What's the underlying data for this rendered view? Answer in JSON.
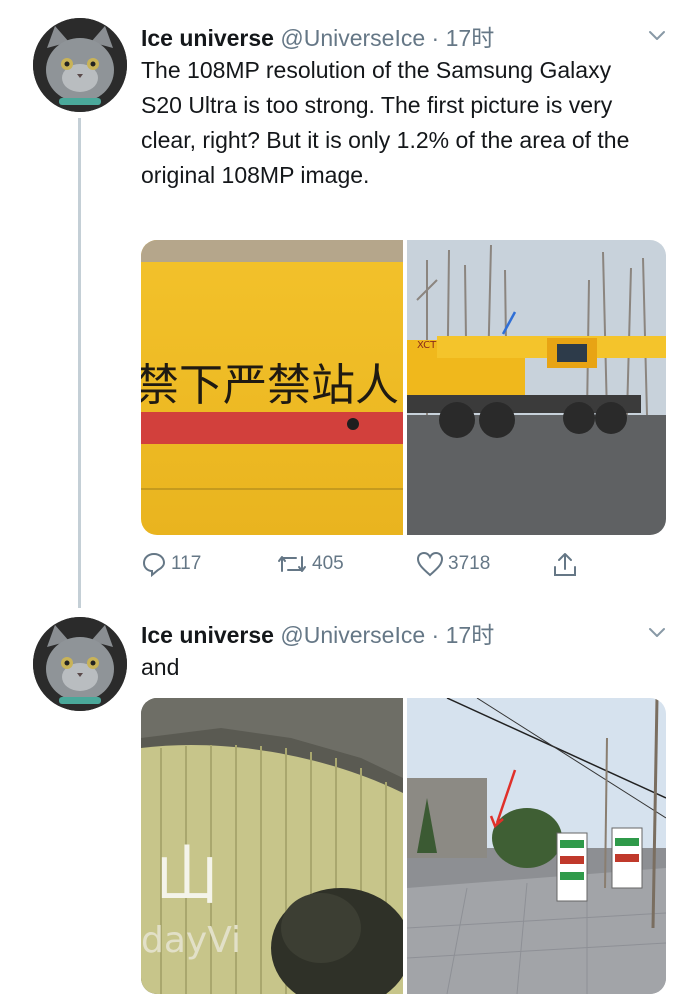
{
  "tweets": [
    {
      "name": "Ice universe",
      "handle": "@UniverseIce",
      "dot": "·",
      "time": "17时",
      "text": "The 108MP resolution of the Samsung Galaxy S20 Ultra is too strong. The first picture is very clear, right? But it is only 1.2% of the area of the original 108MP image.",
      "media": {
        "left_sign_text": "禁下严禁站人",
        "right_truck_text": "XCT"
      },
      "actions": {
        "replies": "117",
        "retweets": "405",
        "likes": "3718"
      }
    },
    {
      "name": "Ice universe",
      "handle": "@UniverseIce",
      "dot": "·",
      "time": "17时",
      "text": "and",
      "media": {
        "left_sign_text": "山",
        "left_sign_text2": "dayVi"
      }
    }
  ],
  "colors": {
    "accent": "#1da1f2",
    "muted": "#657786",
    "thread_line": "#c4cfd6"
  }
}
